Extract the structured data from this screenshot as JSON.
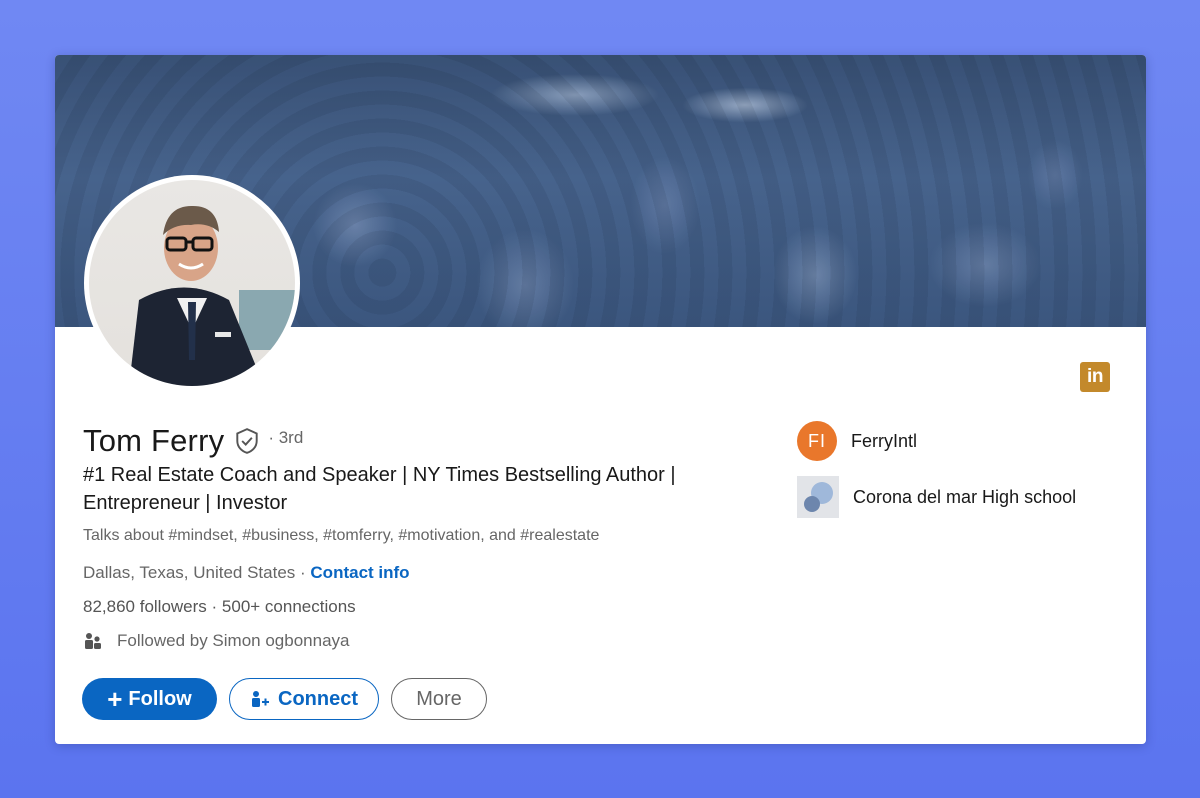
{
  "profile": {
    "name": "Tom Ferry",
    "degree": "· 3rd",
    "headline": "#1 Real Estate Coach and Speaker | NY Times Bestselling Author | Entrepreneur | Investor",
    "talks_about": "Talks about #mindset, #business, #tomferry, #motivation, and #realestate",
    "location": "Dallas, Texas, United States",
    "location_sep": " · ",
    "contact_info": "Contact info",
    "followers": "82,860 followers",
    "connections": " · 500+ connections",
    "followed_by": "Followed by Simon ogbonnaya"
  },
  "actions": {
    "follow_icon": "+",
    "follow_label": "Follow",
    "connect_label": "Connect",
    "more_label": "More"
  },
  "side": {
    "company_initials": "FI",
    "company_name": "FerryIntl",
    "school_name": "Corona del mar High school"
  },
  "badge": {
    "linkedin_text": "in"
  },
  "colors": {
    "accent": "#0a66c2",
    "company_logo": "#e9772b",
    "linkedin_badge": "#c3892b",
    "banner": "#3e5a82"
  },
  "icons": [
    "verified-shield-icon",
    "people-icon",
    "plus-icon",
    "add-person-icon",
    "linkedin-icon"
  ]
}
